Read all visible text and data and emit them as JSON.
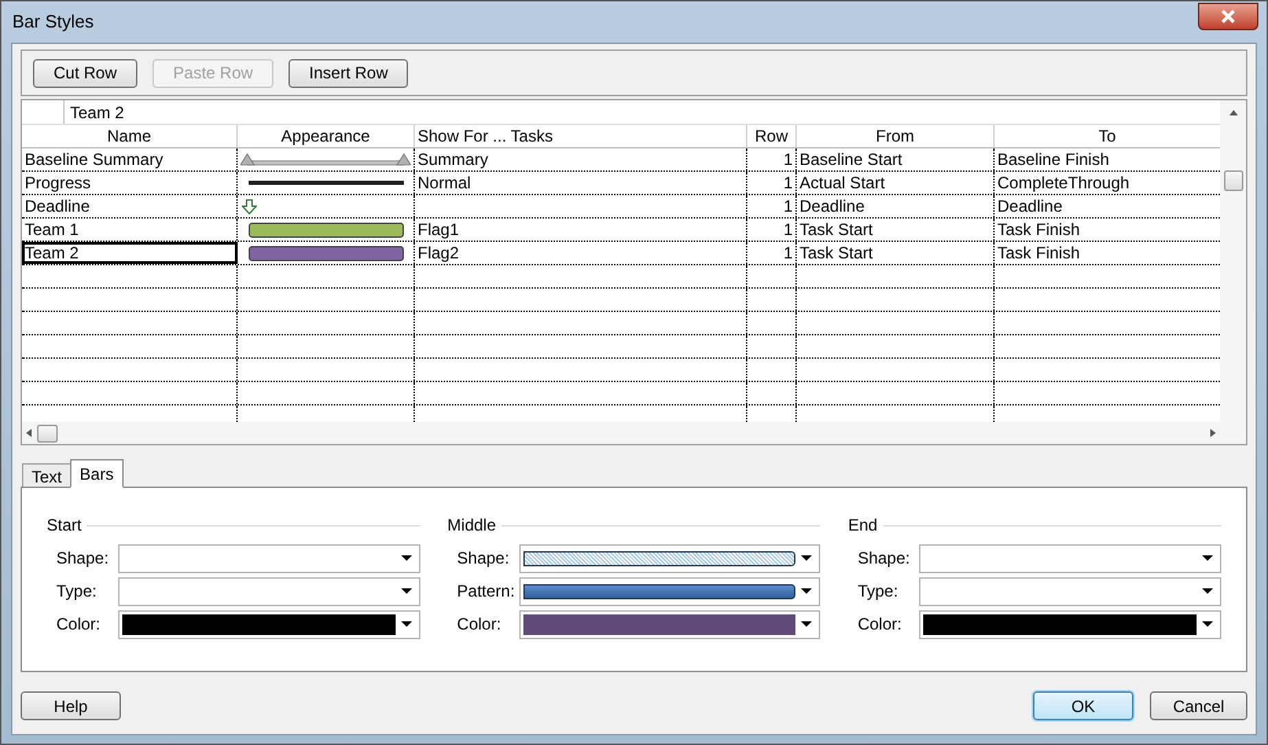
{
  "window": {
    "title": "Bar Styles"
  },
  "toolbar": [
    {
      "label": "Cut Row",
      "disabled": false
    },
    {
      "label": "Paste Row",
      "disabled": true
    },
    {
      "label": "Insert Row",
      "disabled": false
    }
  ],
  "edit_field": {
    "value": "Team 2"
  },
  "table": {
    "columns": [
      "Name",
      "Appearance",
      "Show For ... Tasks",
      "Row",
      "From",
      "To"
    ],
    "rows": [
      {
        "name": "Baseline Summary",
        "appearance": {
          "kind": "summary",
          "color": "#c0c0c0"
        },
        "show_for": "Summary",
        "row": "1",
        "from": "Baseline Start",
        "to": "Baseline Finish",
        "selected": false
      },
      {
        "name": "Progress",
        "appearance": {
          "kind": "line",
          "color": "#202020"
        },
        "show_for": "Normal",
        "row": "1",
        "from": "Actual Start",
        "to": "CompleteThrough",
        "selected": false
      },
      {
        "name": "Deadline",
        "appearance": {
          "kind": "arrow",
          "color": "#3a7a3a"
        },
        "row": "1",
        "from": "Deadline",
        "to": "Deadline",
        "selected": false
      },
      {
        "name": "Team 1",
        "appearance": {
          "kind": "bar",
          "color": "#9bbb59"
        },
        "show_for": "Flag1",
        "row": "1",
        "from": "Task Start",
        "to": "Task Finish",
        "selected": false
      },
      {
        "name": "Team 2",
        "appearance": {
          "kind": "bar",
          "color": "#8064a2"
        },
        "show_for": "Flag2",
        "row": "1",
        "from": "Task Start",
        "to": "Task Finish",
        "selected": true
      }
    ]
  },
  "tabs": [
    {
      "label": "Text",
      "selected": false
    },
    {
      "label": "Bars",
      "selected": true
    }
  ],
  "groups": [
    {
      "title": "Start",
      "fields": [
        {
          "label": "Shape:",
          "kind": "empty"
        },
        {
          "label": "Type:",
          "kind": "empty"
        },
        {
          "label": "Color:",
          "kind": "color",
          "color": "#000000"
        }
      ]
    },
    {
      "title": "Middle",
      "fields": [
        {
          "label": "Shape:",
          "kind": "hatched-bar",
          "color": "#a8cce8"
        },
        {
          "label": "Pattern:",
          "kind": "solid-bar",
          "color": "#5b8fd0"
        },
        {
          "label": "Color:",
          "kind": "color",
          "color": "#604a7b"
        }
      ]
    },
    {
      "title": "End",
      "fields": [
        {
          "label": "Shape:",
          "kind": "empty"
        },
        {
          "label": "Type:",
          "kind": "empty"
        },
        {
          "label": "Color:",
          "kind": "color",
          "color": "#000000"
        }
      ]
    }
  ],
  "buttons": [
    {
      "label": "Help",
      "default": false
    },
    {
      "label": "OK",
      "default": true
    },
    {
      "label": "Cancel",
      "default": false
    }
  ]
}
